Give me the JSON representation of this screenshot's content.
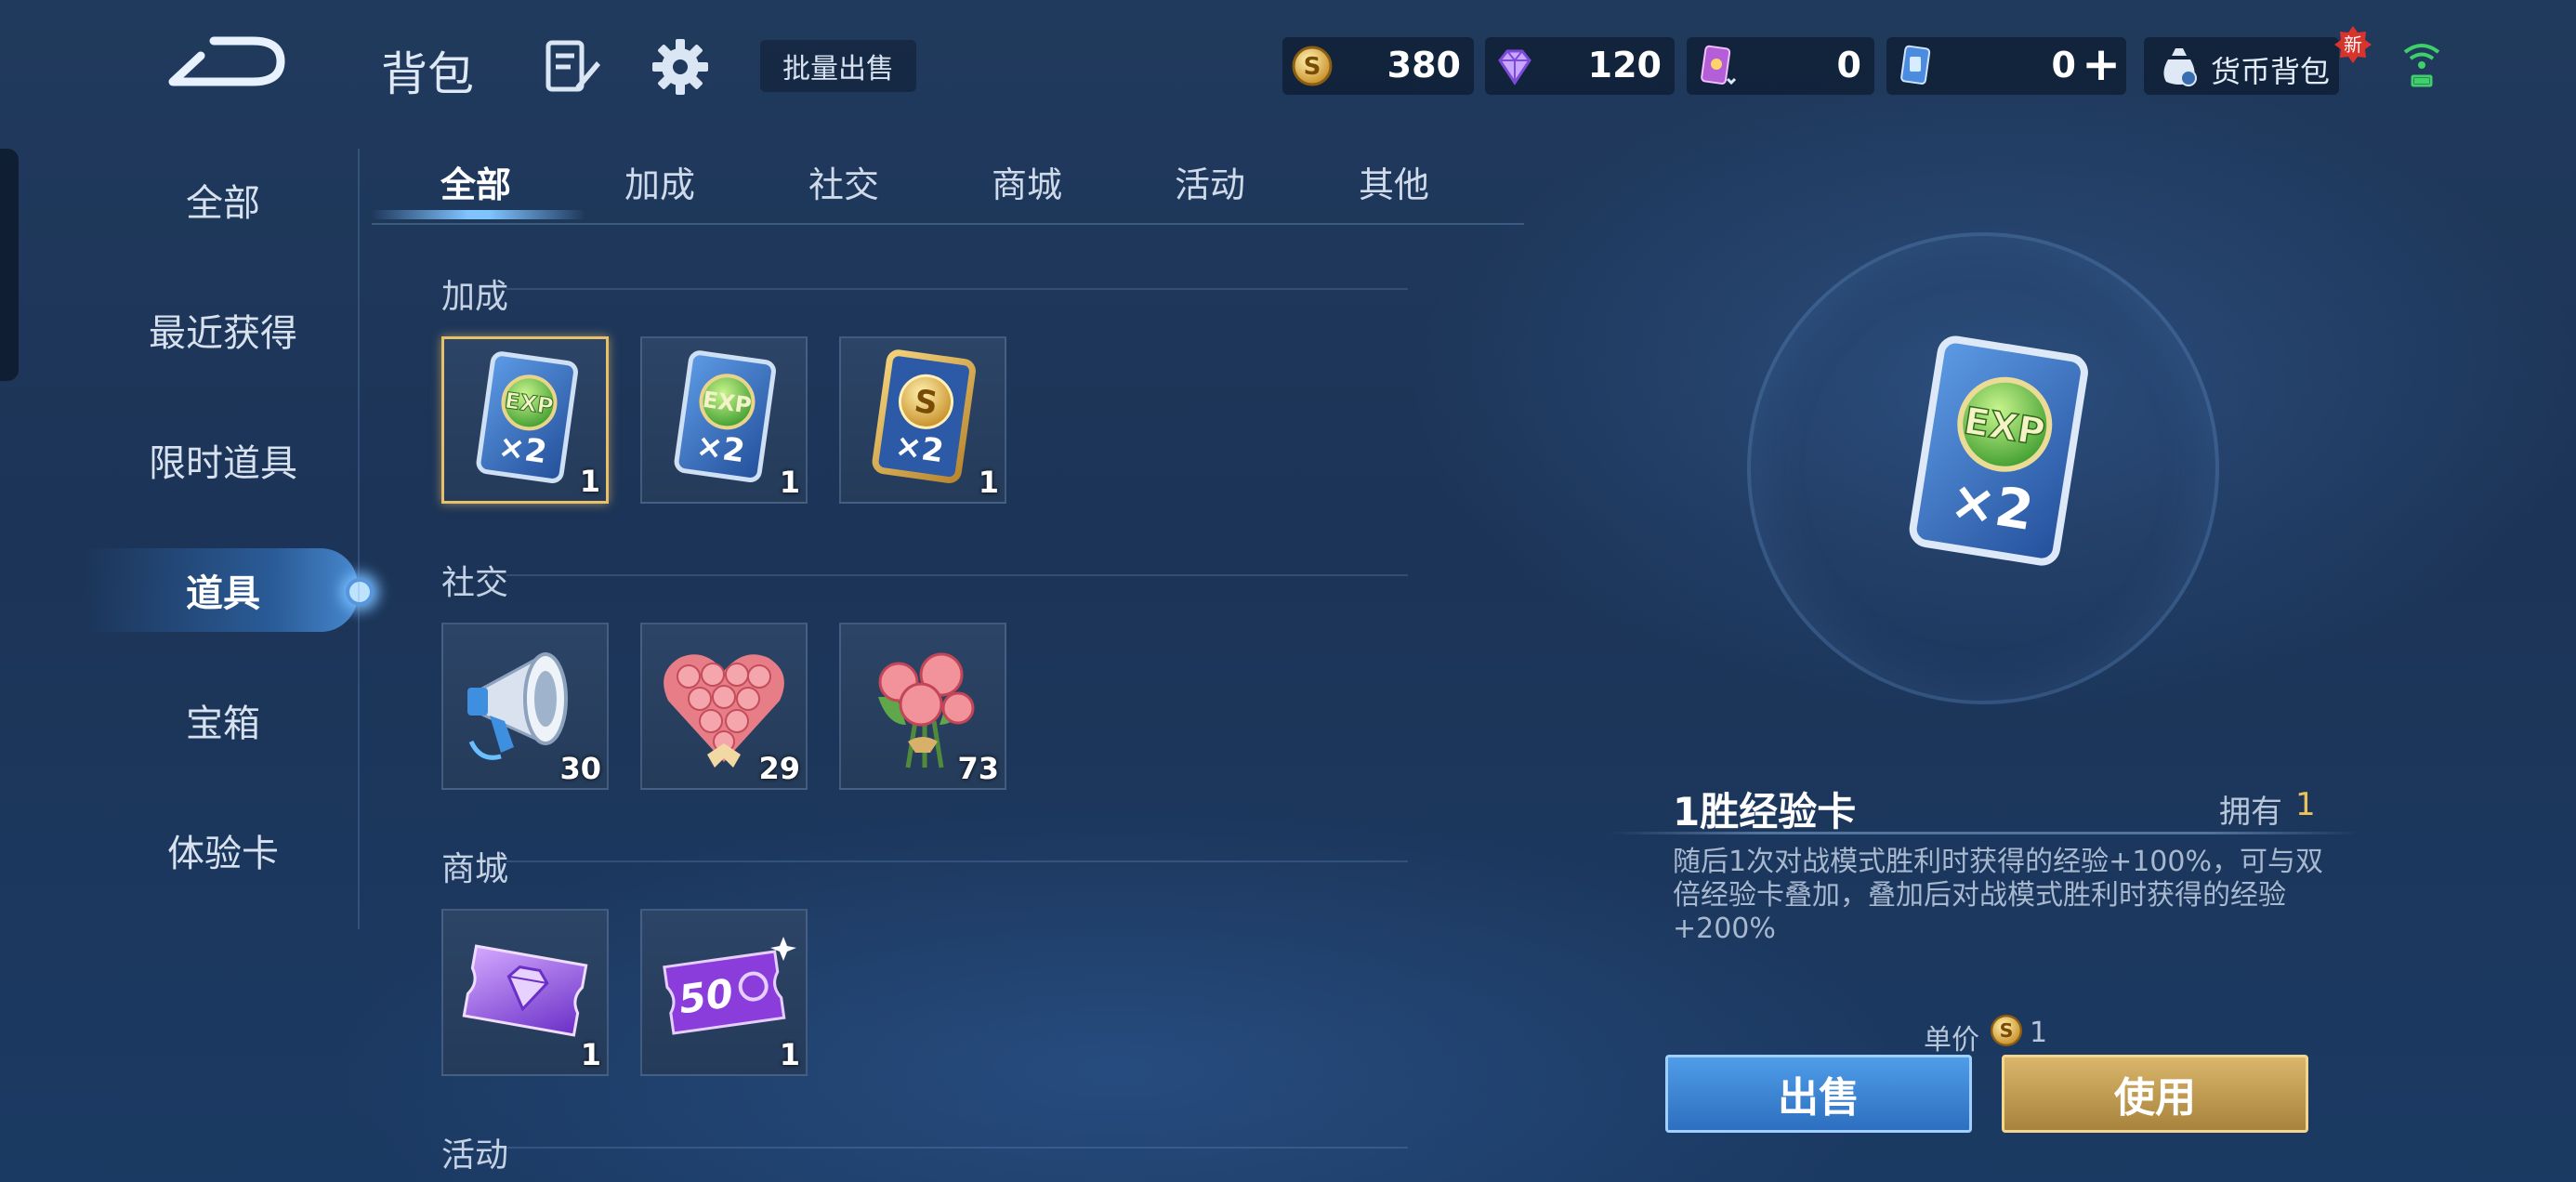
{
  "header": {
    "title": "背包",
    "bulk_sell_label": "批量出售",
    "currencies": [
      {
        "name": "gold-coin-icon",
        "value": "380"
      },
      {
        "name": "diamond-icon",
        "value": "120"
      },
      {
        "name": "purple-card-icon",
        "value": "0"
      },
      {
        "name": "blue-card-icon",
        "value": "0"
      }
    ],
    "currency_bag_label": "货币背包",
    "new_badge": "新"
  },
  "sidebar": {
    "items": [
      {
        "label": "全部"
      },
      {
        "label": "最近获得"
      },
      {
        "label": "限时道具"
      },
      {
        "label": "道具"
      },
      {
        "label": "宝箱"
      },
      {
        "label": "体验卡"
      }
    ],
    "active_index": 3
  },
  "tabs": {
    "items": [
      {
        "label": "全部"
      },
      {
        "label": "加成"
      },
      {
        "label": "社交"
      },
      {
        "label": "商城"
      },
      {
        "label": "活动"
      },
      {
        "label": "其他"
      }
    ],
    "active_index": 0
  },
  "sections": [
    {
      "title": "加成",
      "items": [
        {
          "icon": "exp-card-icon",
          "count": "1"
        },
        {
          "icon": "exp-card-icon",
          "count": "1"
        },
        {
          "icon": "gold-card-icon",
          "count": "1"
        }
      ]
    },
    {
      "title": "社交",
      "items": [
        {
          "icon": "megaphone-icon",
          "count": "30"
        },
        {
          "icon": "rose-heart-icon",
          "count": "29"
        },
        {
          "icon": "rose-bouquet-icon",
          "count": "73"
        }
      ]
    },
    {
      "title": "商城",
      "items": [
        {
          "icon": "diamond-ticket-icon",
          "count": "1"
        },
        {
          "icon": "coupon-ticket-icon",
          "count": "1",
          "coupon_text": "50"
        }
      ]
    },
    {
      "title": "活动",
      "items": []
    }
  ],
  "detail": {
    "name": "1胜经验卡",
    "own_label": "拥有",
    "own_value": "1",
    "description": "随后1次对战模式胜利时获得的经验+100%，可与双倍经验卡叠加，叠加后对战模式胜利时获得的经验+200%",
    "price_label": "单价",
    "price_value": "1",
    "sell_label": "出售",
    "use_label": "使用"
  },
  "card_text": {
    "exp": "EXP",
    "x2": "×2",
    "s": "S"
  },
  "colors": {
    "accent_gold": "#e9c25a",
    "accent_blue": "#3f86d6",
    "bg": "#1d3659"
  }
}
